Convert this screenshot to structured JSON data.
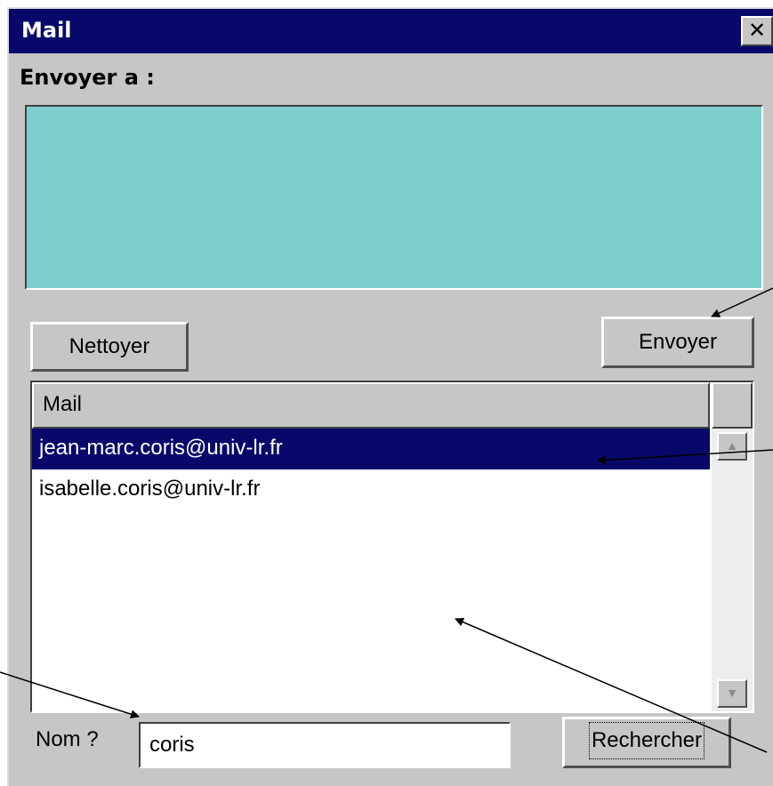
{
  "window": {
    "title": "Mail",
    "close_label": "✕"
  },
  "compose": {
    "to_label": "Envoyer a :"
  },
  "buttons": {
    "clear": "Nettoyer",
    "send": "Envoyer",
    "search": "Rechercher"
  },
  "results": {
    "column_header": "Mail",
    "rows": [
      "jean-marc.coris@univ-lr.fr",
      "isabelle.coris@univ-lr.fr"
    ],
    "selected_index": 0
  },
  "search": {
    "label": "Nom ?",
    "value": "coris"
  },
  "colors": {
    "titlebar": "#08086b",
    "recipients_bg": "#7fcfcf",
    "window_bg": "#c6c6c6",
    "selected_row": "#08086b"
  }
}
